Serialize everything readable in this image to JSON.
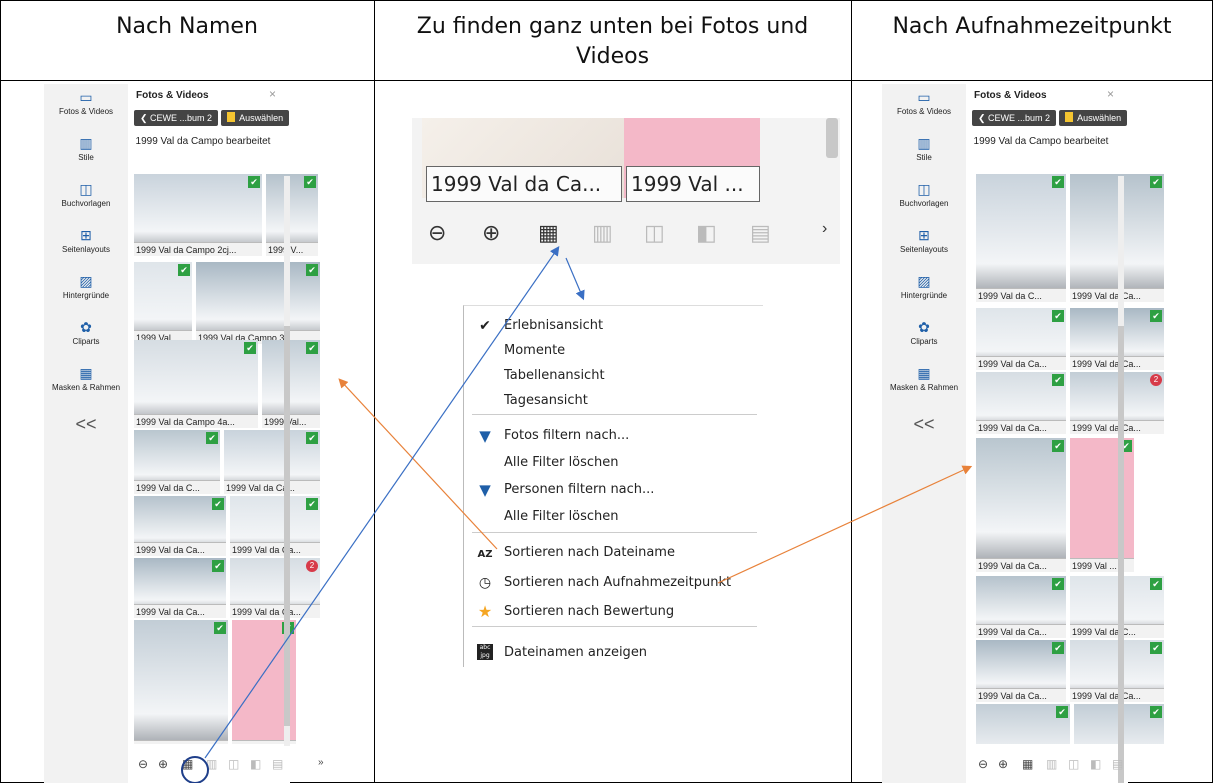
{
  "headers": {
    "left": "Nach Namen",
    "middle_line1": "Zu finden ganz unten bei Fotos und",
    "middle_line2": "Videos",
    "right": "Nach Aufnahmezeitpunkt"
  },
  "panel": {
    "title": "Fotos & Videos",
    "close": "×",
    "back_label": "❮ CEWE ...bum 2",
    "select_label": "Auswählen",
    "album_name": "1999 Val da Campo bearbeitet",
    "rail": [
      {
        "label": "Fotos & Videos",
        "icon": "photos-icon"
      },
      {
        "label": "Stile",
        "icon": "styles-icon"
      },
      {
        "label": "Buchvorlagen",
        "icon": "book-templates-icon"
      },
      {
        "label": "Seitenlayouts",
        "icon": "page-layouts-icon"
      },
      {
        "label": "Hintergründe",
        "icon": "backgrounds-icon"
      },
      {
        "label": "Cliparts",
        "icon": "cliparts-icon"
      },
      {
        "label": "Masken & Rahmen",
        "icon": "masks-frames-icon"
      }
    ],
    "collapse": "<<"
  },
  "left_captions": [
    "1999 Val da Campo 2cj...",
    "1999 V...",
    "1999 Val...",
    "1999 Val da Campo 3c...",
    "1999 Val da Campo 4a...",
    "1999 Val...",
    "1999 Val da C...",
    "1999 Val da Ca...",
    "1999 Val da Ca...",
    "1999 Val da Ca...",
    "1999 Val da Ca...",
    "1999 Val da Ca...",
    "1999 Val da Ca...",
    "1999 Val ..."
  ],
  "right_captions": [
    "1999 Val da C...",
    "1999 Val da Ca...",
    "1999 Val da Ca...",
    "1999 Val da Ca...",
    "1999 Val da Ca...",
    "1999 Val da Ca...",
    "1999 Val da Ca...",
    "1999 Val ...",
    "1999 Val da Ca...",
    "1999 Val da C...",
    "1999 Val da Ca...",
    "1999 Val da Ca..."
  ],
  "badge_count": "2",
  "zoom": {
    "caption1": "1999 Val da Ca...",
    "caption2": "1999 Val ..."
  },
  "menu": {
    "items": [
      {
        "label": "Erlebnisansicht",
        "icon": "✔"
      },
      {
        "label": "Momente",
        "icon": ""
      },
      {
        "label": "Tabellenansicht",
        "icon": ""
      },
      {
        "label": "Tagesansicht",
        "icon": ""
      },
      {
        "label": "Fotos filtern nach...",
        "icon": "filter-icon"
      },
      {
        "label": "Alle Filter löschen",
        "icon": ""
      },
      {
        "label": "Personen filtern nach...",
        "icon": "filter-icon"
      },
      {
        "label": "Alle Filter löschen",
        "icon": ""
      },
      {
        "label": "Sortieren nach Dateiname",
        "icon": "sort-az-icon"
      },
      {
        "label": "Sortieren nach Aufnahmezeitpunkt",
        "icon": "clock-icon"
      },
      {
        "label": "Sortieren nach Bewertung",
        "icon": "star-icon"
      },
      {
        "label": "Dateinamen anzeigen",
        "icon": "abc-jpg-icon"
      }
    ]
  },
  "colors": {
    "check_green": "#2ea043",
    "badge_red": "#d73a49",
    "arrow_orange": "#e8823a",
    "arrow_blue": "#3a6fc4",
    "filter_blue": "#1f5fa8",
    "star_orange": "#f5a623"
  }
}
